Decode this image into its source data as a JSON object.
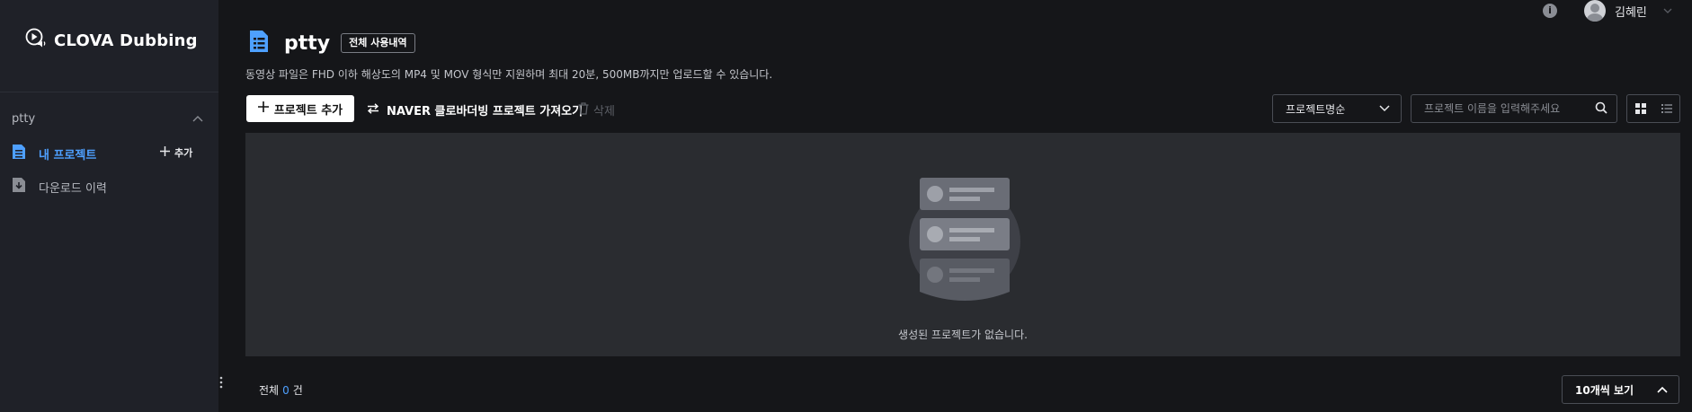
{
  "app": {
    "name": "CLOVA Dubbing"
  },
  "sidebar": {
    "workspace": "ptty",
    "items": [
      {
        "label": "내 프로젝트",
        "active": true
      },
      {
        "label": "다운로드 이력",
        "active": false
      }
    ],
    "add_label": "추가"
  },
  "user": {
    "name": "김혜린"
  },
  "header": {
    "title": "ptty",
    "usage_button": "전체 사용내역",
    "subtitle": "동영상 파일은 FHD 이하 해상도의 MP4 및 MOV 형식만 지원하며 최대 20분, 500MB까지만 업로드할 수 있습니다."
  },
  "toolbar": {
    "add_project": "프로젝트 추가",
    "import": "NAVER 클로바더빙 프로젝트 가져오기",
    "delete": "삭제",
    "sort": "프로젝트명순",
    "search_placeholder": "프로젝트 이름을 입력해주세요"
  },
  "empty": {
    "message": "생성된 프로젝트가 없습니다."
  },
  "footer": {
    "total_prefix": "전체",
    "total_count": "0",
    "total_suffix": "건",
    "page_size": "10개씩 보기"
  },
  "colors": {
    "accent": "#4ea0ff",
    "sidebar_bg": "#1f2128",
    "page_bg": "#151619",
    "panel_bg": "#2a2c30"
  }
}
